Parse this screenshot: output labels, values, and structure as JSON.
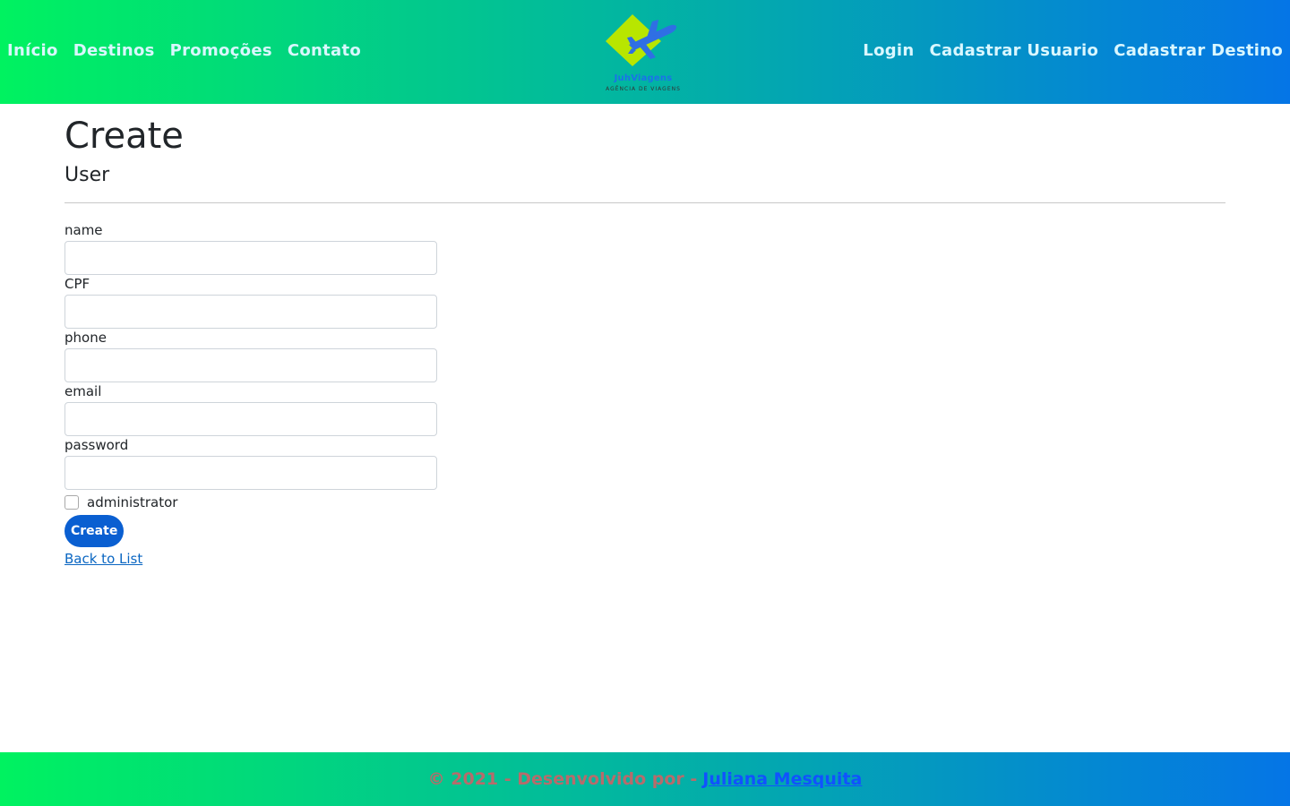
{
  "header": {
    "nav_left": [
      "Início",
      "Destinos",
      "Promoções",
      "Contato"
    ],
    "nav_right": [
      "Login",
      "Cadastrar Usuario",
      "Cadastrar Destino"
    ],
    "logo": {
      "brand": "JuhViagens",
      "tagline": "AGÊNCIA DE VIAGENS",
      "icon": "airplane-icon"
    }
  },
  "main": {
    "title": "Create",
    "subtitle": "User",
    "fields": [
      {
        "label": "name",
        "value": ""
      },
      {
        "label": "CPF",
        "value": ""
      },
      {
        "label": "phone",
        "value": ""
      },
      {
        "label": "email",
        "value": ""
      },
      {
        "label": "password",
        "value": ""
      }
    ],
    "administrator": {
      "label": "administrator",
      "checked": false
    },
    "submit_label": "Create",
    "back_link": "Back to List"
  },
  "footer": {
    "text": "© 2021 - Desenvolvido por -",
    "author_link": "Juliana Mesquita"
  },
  "colors": {
    "gradient_start": "#00f260",
    "gradient_end": "#0575e6",
    "button": "#0a5fd1",
    "logo_diamond": "#b8e600",
    "footer_text": "#b76b6b"
  }
}
